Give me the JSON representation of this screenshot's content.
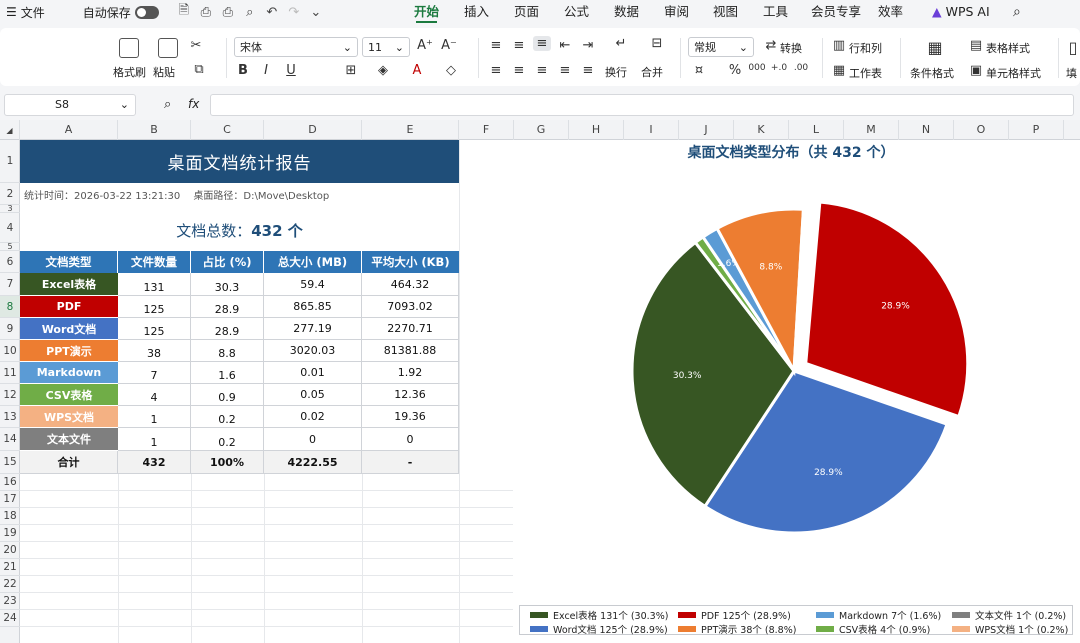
{
  "menubar": {
    "file": "文件",
    "autosave": "自动保存",
    "tabs": [
      "开始",
      "插入",
      "页面",
      "公式",
      "数据",
      "审阅",
      "视图",
      "工具",
      "会员专享",
      "效率",
      "WPS AI"
    ],
    "active_tab": "开始"
  },
  "ribbon": {
    "format_painter": "格式刷",
    "paste": "粘贴",
    "font_name": "宋体",
    "font_size": "11",
    "number_format": "常规",
    "convert": "转换",
    "rows_cols": "行和列",
    "table_style": "表格样式",
    "wrap": "换行",
    "merge": "合并",
    "worksheet": "工作表",
    "cond_format": "条件格式",
    "cell_style": "单元格样式",
    "fill": "填"
  },
  "formula_bar": {
    "cell_ref": "S8",
    "fx": "fx",
    "content": ""
  },
  "grid": {
    "columns": [
      "A",
      "B",
      "C",
      "D",
      "E",
      "F",
      "G",
      "H",
      "I",
      "J",
      "K",
      "L",
      "M",
      "N",
      "O",
      "P"
    ],
    "rows": [
      "1",
      "2",
      "3",
      "4",
      "5",
      "6",
      "7",
      "8",
      "9",
      "10",
      "11",
      "12",
      "13",
      "14",
      "15",
      "16",
      "17",
      "18",
      "19",
      "20",
      "21",
      "22",
      "23",
      "24"
    ],
    "selected_row": "8"
  },
  "report": {
    "title": "桌面文档统计报告",
    "stats_time_label": "统计时间：",
    "stats_time": "2026-03-22 13:21:30",
    "path_label": "桌面路径：",
    "path": "D:\\Move\\Desktop",
    "total_label": "文档总数：",
    "total_value": "432 个"
  },
  "table": {
    "headers": [
      "文档类型",
      "文件数量",
      "占比 (%)",
      "总大小 (MB)",
      "平均大小 (KB)"
    ],
    "rows": [
      {
        "type": "Excel表格",
        "count": "131",
        "pct": "30.3",
        "size": "59.4",
        "avg": "464.32",
        "color": "#375623"
      },
      {
        "type": "PDF",
        "count": "125",
        "pct": "28.9",
        "size": "865.85",
        "avg": "7093.02",
        "color": "#c00000"
      },
      {
        "type": "Word文档",
        "count": "125",
        "pct": "28.9",
        "size": "277.19",
        "avg": "2270.71",
        "color": "#4472c4"
      },
      {
        "type": "PPT演示",
        "count": "38",
        "pct": "8.8",
        "size": "3020.03",
        "avg": "81381.88",
        "color": "#ed7d31"
      },
      {
        "type": "Markdown",
        "count": "7",
        "pct": "1.6",
        "size": "0.01",
        "avg": "1.92",
        "color": "#5b9bd5"
      },
      {
        "type": "CSV表格",
        "count": "4",
        "pct": "0.9",
        "size": "0.05",
        "avg": "12.36",
        "color": "#70ad47"
      },
      {
        "type": "WPS文档",
        "count": "1",
        "pct": "0.2",
        "size": "0.02",
        "avg": "19.36",
        "color": "#f4b183"
      },
      {
        "type": "文本文件",
        "count": "1",
        "pct": "0.2",
        "size": "0",
        "avg": "0",
        "color": "#7f7f7f"
      }
    ],
    "total": {
      "label": "合计",
      "count": "432",
      "pct": "100%",
      "size": "4222.55",
      "avg": "-"
    }
  },
  "chart_data": {
    "type": "pie",
    "title": "桌面文档类型分布（共 432 个）",
    "start_angle_deg": 5,
    "slices": [
      {
        "name": "PDF",
        "value": 125,
        "pct": 28.9,
        "label": "28.9%",
        "color": "#c00000",
        "explode": true
      },
      {
        "name": "Word文档",
        "value": 125,
        "pct": 28.9,
        "label": "28.9%",
        "color": "#4472c4",
        "explode": false
      },
      {
        "name": "Excel表格",
        "value": 131,
        "pct": 30.3,
        "label": "30.3%",
        "color": "#375623",
        "explode": false
      },
      {
        "name": "CSV表格",
        "value": 4,
        "pct": 0.9,
        "label": "",
        "color": "#70ad47",
        "explode": false
      },
      {
        "name": "Markdown",
        "value": 7,
        "pct": 1.6,
        "label": "1.6%",
        "color": "#5b9bd5",
        "explode": false
      },
      {
        "name": "PPT演示",
        "value": 38,
        "pct": 8.8,
        "label": "8.8%",
        "color": "#ed7d31",
        "explode": false
      },
      {
        "name": "WPS文档",
        "value": 1,
        "pct": 0.2,
        "label": "",
        "color": "#f4b183",
        "explode": false
      },
      {
        "name": "文本文件",
        "value": 1,
        "pct": 0.2,
        "label": "",
        "color": "#7f7f7f",
        "explode": false
      }
    ],
    "legend": [
      {
        "text": "Excel表格  131个 (30.3%)",
        "color": "#375623"
      },
      {
        "text": "PDF  125个 (28.9%)",
        "color": "#c00000"
      },
      {
        "text": "Markdown  7个 (1.6%)",
        "color": "#5b9bd5"
      },
      {
        "text": "文本文件  1个 (0.2%)",
        "color": "#7f7f7f"
      },
      {
        "text": "Word文档  125个 (28.9%)",
        "color": "#4472c4"
      },
      {
        "text": "PPT演示  38个 (8.8%)",
        "color": "#ed7d31"
      },
      {
        "text": "CSV表格  4个 (0.9%)",
        "color": "#70ad47"
      },
      {
        "text": "WPS文档  1个 (0.2%)",
        "color": "#f4b183"
      }
    ],
    "legend_position": "bottom"
  }
}
